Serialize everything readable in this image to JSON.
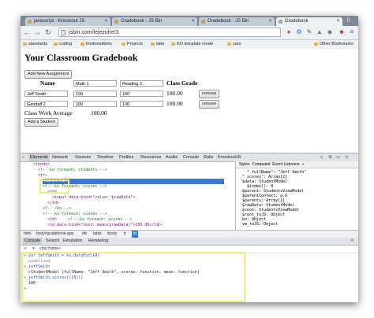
{
  "browser": {
    "tabs": [
      {
        "label": "javascript - Knockout JS"
      },
      {
        "label": "Gradebook - JS Bin"
      },
      {
        "label": "Gradebook - JS Bin"
      },
      {
        "label": "Gradebook"
      }
    ],
    "url": "jsbin.com/lejezuhe/3",
    "bookmarks": [
      "standards",
      "coding",
      "bookmarklets",
      "Projects",
      "later",
      "KO template rende",
      "caro"
    ],
    "other_bookmarks": "Other Bookmarks"
  },
  "page": {
    "title": "Your Classroom Gradebook",
    "add_assignment": "Add New Assignment",
    "headers": {
      "name": "Name",
      "class_grade": "Class Grade"
    },
    "assignment_inputs": [
      "Math 1",
      "Reading 2"
    ],
    "students": [
      {
        "name": "Jeff Smith",
        "scores": [
          "100",
          "100"
        ],
        "mean": "100.00",
        "remove": "remove"
      },
      {
        "name": "Gandalf 2",
        "scores": [
          "100",
          "100"
        ],
        "mean": "100.00",
        "remove": "remove"
      }
    ],
    "class_average_label": "Class Work Average",
    "class_average": "100.00",
    "add_student": "Add a Student"
  },
  "devtools": {
    "tabs": [
      "Elements",
      "Network",
      "Sources",
      "Timeline",
      "Profiles",
      "Resources",
      "Audits",
      "Console",
      "Rails",
      "KnockoutJS"
    ],
    "side_tabs": [
      "Styles",
      "Computed",
      "Event Listeners",
      "»"
    ],
    "dom_lines": [
      "<tbody>",
      "<!-- ko foreach: students -->",
      "<tr>",
      "<td>…</td>",
      "<!-- ko foreach: scores -->",
      "<td>",
      "<input data-bind=\"value: $rawData\">",
      "</td>",
      "<!-- /ko -->",
      "<!-- ko foreach: scores -->",
      "<td>",
      "<!-- ko foreach: scores -->",
      "<td data-bind=\"text: mean($rawData)\">100.00</td>"
    ],
    "ko_props": [
      "\" fullName\": \"Jeff Smith\"",
      "\" scores\": Array[2]",
      "$data: StudentModel",
      "$index(): 0",
      "$parent: StudentsViewModel",
      "$parentContext: a.G",
      "$parents: Array[1]",
      "$rawData: StudentModel",
      "$root: StudentsViewModel",
      "$root_toJS: Object",
      "ko: Object",
      "vm_toJS: Object"
    ],
    "breadcrumbs": [
      "html",
      "body#gradebook-app",
      "div",
      "table",
      "tbody",
      "tr",
      "td"
    ],
    "console_tabs": [
      "Console",
      "Search",
      "Emulation",
      "Rendering"
    ],
    "frame": "<top frame>",
    "console_lines": [
      {
        "kind": "in",
        "text": "var jeffSmith = ko.dataFor($0)"
      },
      {
        "kind": "dim",
        "text": "undefined"
      },
      {
        "kind": "in",
        "text": "jeffSmith"
      },
      {
        "kind": "out",
        "text": "▸StudentModel {fullName: \"Jeff Smith\", scores: function, mean: function}"
      },
      {
        "kind": "in",
        "text": "jeffSmith.scores()[0]()"
      },
      {
        "kind": "out",
        "text": "100"
      },
      {
        "kind": "in",
        "text": ""
      }
    ]
  },
  "colors": {
    "highlight": "#f2eb7c",
    "selection": "#3879d9"
  }
}
